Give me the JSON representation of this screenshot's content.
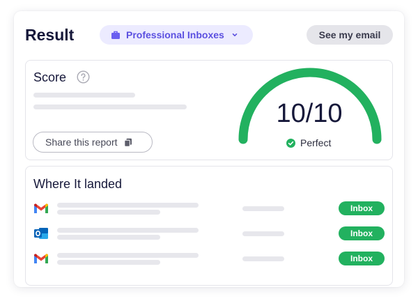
{
  "header": {
    "title": "Result",
    "inbox_type": {
      "label": "Professional Inboxes",
      "icon": "briefcase-icon",
      "color": "#5b50e0"
    },
    "see_email_label": "See my email"
  },
  "score": {
    "title": "Score",
    "help_icon": "question-circle-icon",
    "share_label": "Share this report",
    "share_icon": "copy-icon",
    "value": "10/10",
    "fraction": 1.0,
    "status": "Perfect",
    "status_icon": "check-circle-icon",
    "gauge_color": "#22b15f"
  },
  "landed": {
    "title": "Where It landed",
    "rows": [
      {
        "provider_icon": "gmail-icon",
        "badge": "Inbox"
      },
      {
        "provider_icon": "outlook-icon",
        "badge": "Inbox"
      },
      {
        "provider_icon": "gmail-icon",
        "badge": "Inbox"
      }
    ]
  }
}
